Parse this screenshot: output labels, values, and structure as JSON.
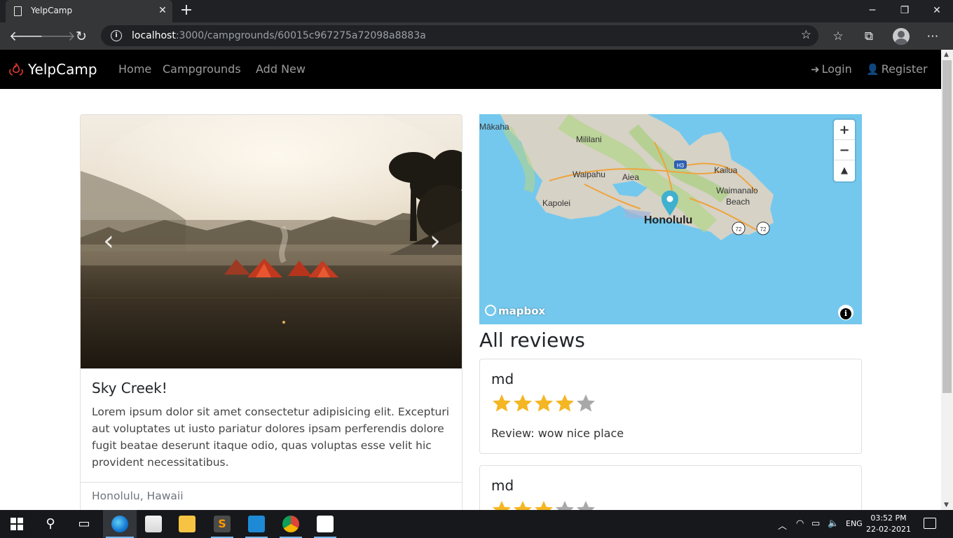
{
  "browser": {
    "tab_title": "YelpCamp",
    "url_host": "localhost",
    "url_path": ":3000/campgrounds/60015c967275a72098a8883a",
    "tab_close": "✕",
    "new_tab": "+",
    "window_controls": {
      "minimize": "─",
      "maximize": "❐",
      "close": "✕"
    }
  },
  "site_nav": {
    "brand": "YelpCamp",
    "links": [
      "Home",
      "Campgrounds",
      "Add New"
    ],
    "login": "Login",
    "register": "Register"
  },
  "campground": {
    "title": "Sky Creek!",
    "description": "Lorem ipsum dolor sit amet consectetur adipisicing elit. Excepturi aut voluptates ut iusto pariatur dolores ipsam perferendis dolore fugit beatae deserunt itaque odio, quas voluptas esse velit hic provident necessitatibus.",
    "location": "Honolulu, Hawaii"
  },
  "map": {
    "labels": {
      "makaha": "Mākaha",
      "mililani": "Mililani",
      "waipahu": "Waipahu",
      "aiea": "Aiea",
      "kailua": "Kailua",
      "waimanalo": "Waimanalo",
      "beach": "Beach",
      "kapolei": "Kapolei",
      "honolulu": "Honolulu",
      "h3": "H3",
      "route1": "72",
      "route2": "72"
    },
    "attribution": "mapbox",
    "zoom_in": "+",
    "zoom_out": "−",
    "compass": "▲",
    "info": "i"
  },
  "reviews": {
    "heading": "All reviews",
    "items": [
      {
        "author": "md",
        "rating": 4,
        "text": "Review: wow nice place"
      },
      {
        "author": "md",
        "rating": 3,
        "text": ""
      }
    ]
  },
  "taskbar": {
    "language": "ENG",
    "time": "03:52 PM",
    "date": "22-02-2021"
  },
  "colors": {
    "star_filled": "#f5b623",
    "star_empty": "#a8a8a8",
    "map_water": "#74c8ee",
    "nav_bg": "#000000"
  }
}
